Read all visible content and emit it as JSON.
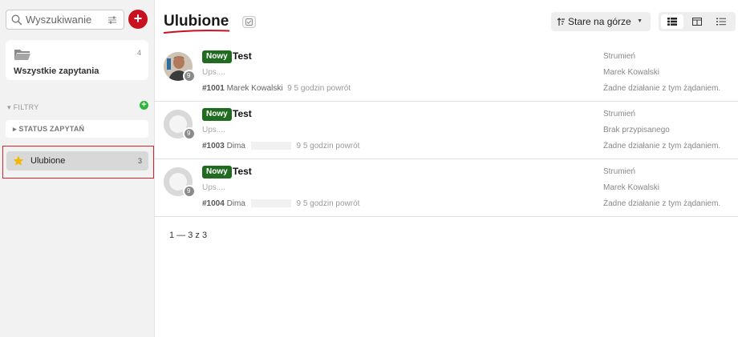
{
  "sidebar": {
    "search_placeholder": "Wyszukiwanie",
    "add_button_label": "+",
    "all_requests": {
      "label": "Wszystkie zapytania",
      "count": "4"
    },
    "filters_label": "▾  FILTRY",
    "add_filter_label": "+",
    "status_label": "▸  STATUS ZAPYTAŃ",
    "favorites": {
      "label": "Ulubione",
      "count": "3"
    }
  },
  "main": {
    "title": "Ulubione",
    "sort_label": "Stare na górze",
    "sort_chevron": "▼",
    "pagination": "1 — 3 z 3"
  },
  "tickets": [
    {
      "status": "Nowy",
      "title": "Test",
      "preview": "Ups....",
      "number": "#1001",
      "author": "Marek Kowalski",
      "time": "9 5 godzin powrót",
      "badge": "9",
      "channel": "Strumień",
      "assignee": "Marek Kowalski",
      "activity": "Żadne działanie z tym żądaniem."
    },
    {
      "status": "Nowy",
      "title": "Test",
      "preview": "Ups....",
      "number": "#1003",
      "author": "Dima",
      "time": "9 5 godzin powrót",
      "badge": "9",
      "channel": "Strumień",
      "assignee": "Brak przypisanego",
      "activity": "Żadne działanie z tym żądaniem."
    },
    {
      "status": "Nowy",
      "title": "Test",
      "preview": "Ups....",
      "number": "#1004",
      "author": "Dima",
      "time": "9 5 godzin powrót",
      "badge": "9",
      "channel": "Strumień",
      "assignee": "Marek Kowalski",
      "activity": "Żadne działanie z tym żądaniem."
    }
  ],
  "colors": {
    "accent_red": "#c8101e",
    "status_green": "#1f6b20",
    "add_filter_green": "#2cb53a",
    "star_yellow": "#f2b705"
  }
}
